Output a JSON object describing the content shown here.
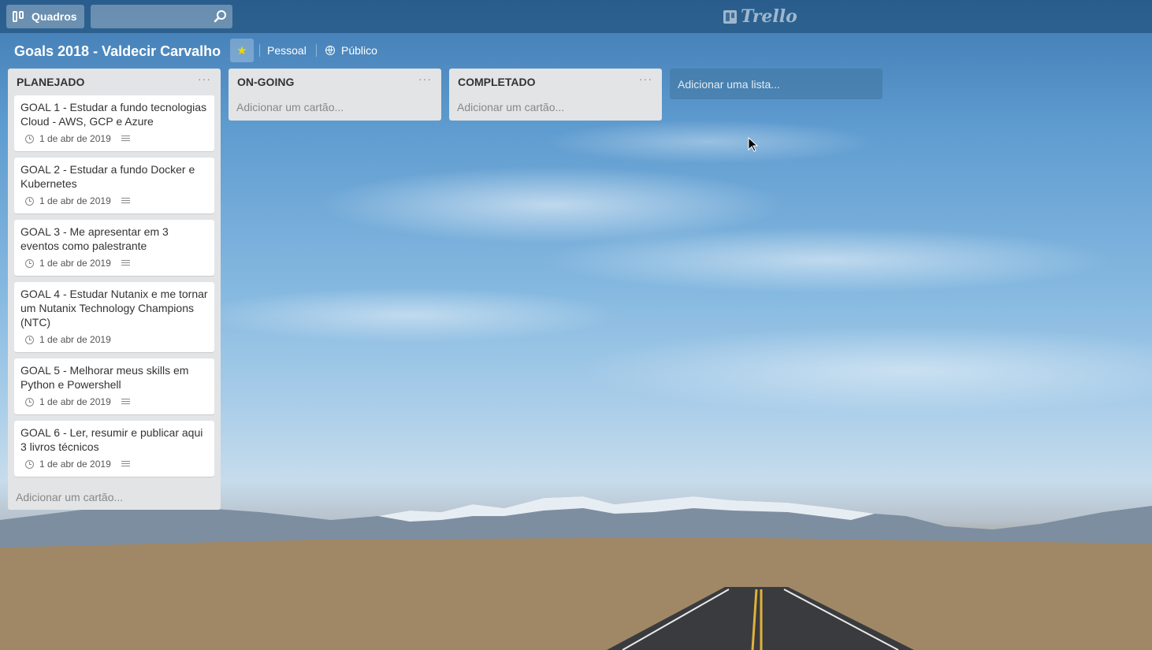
{
  "header": {
    "boards_label": "Quadros",
    "search_placeholder": "",
    "logo_text": "Trello"
  },
  "board": {
    "title": "Goals 2018 - Valdecir Carvalho",
    "team": "Pessoal",
    "visibility": "Público",
    "starred": true,
    "star_color": "#f2d600"
  },
  "lists": [
    {
      "title": "PLANEJADO",
      "menu_label": "···",
      "add_card_label": "Adicionar um cartão...",
      "cards": [
        {
          "title": "GOAL 1 - Estudar a fundo tecnologias Cloud - AWS, GCP e Azure",
          "due": "1 de abr de 2019",
          "has_description": true
        },
        {
          "title": "GOAL 2 - Estudar a fundo Docker e Kubernetes",
          "due": "1 de abr de 2019",
          "has_description": true
        },
        {
          "title": "GOAL 3 - Me apresentar em 3 eventos como palestrante",
          "due": "1 de abr de 2019",
          "has_description": true
        },
        {
          "title": "GOAL 4 - Estudar Nutanix e me tornar um Nutanix Technology Champions (NTC)",
          "due": "1 de abr de 2019",
          "has_description": false
        },
        {
          "title": "GOAL 5 - Melhorar meus skills em Python e Powershell",
          "due": "1 de abr de 2019",
          "has_description": true
        },
        {
          "title": "GOAL 6 - Ler, resumir e publicar aqui 3 livros técnicos",
          "due": "1 de abr de 2019",
          "has_description": true
        }
      ]
    },
    {
      "title": "ON-GOING",
      "menu_label": "···",
      "add_card_label": "Adicionar um cartão...",
      "cards": []
    },
    {
      "title": "COMPLETADO",
      "menu_label": "···",
      "add_card_label": "Adicionar um cartão...",
      "cards": []
    }
  ],
  "add_list_label": "Adicionar uma lista..."
}
